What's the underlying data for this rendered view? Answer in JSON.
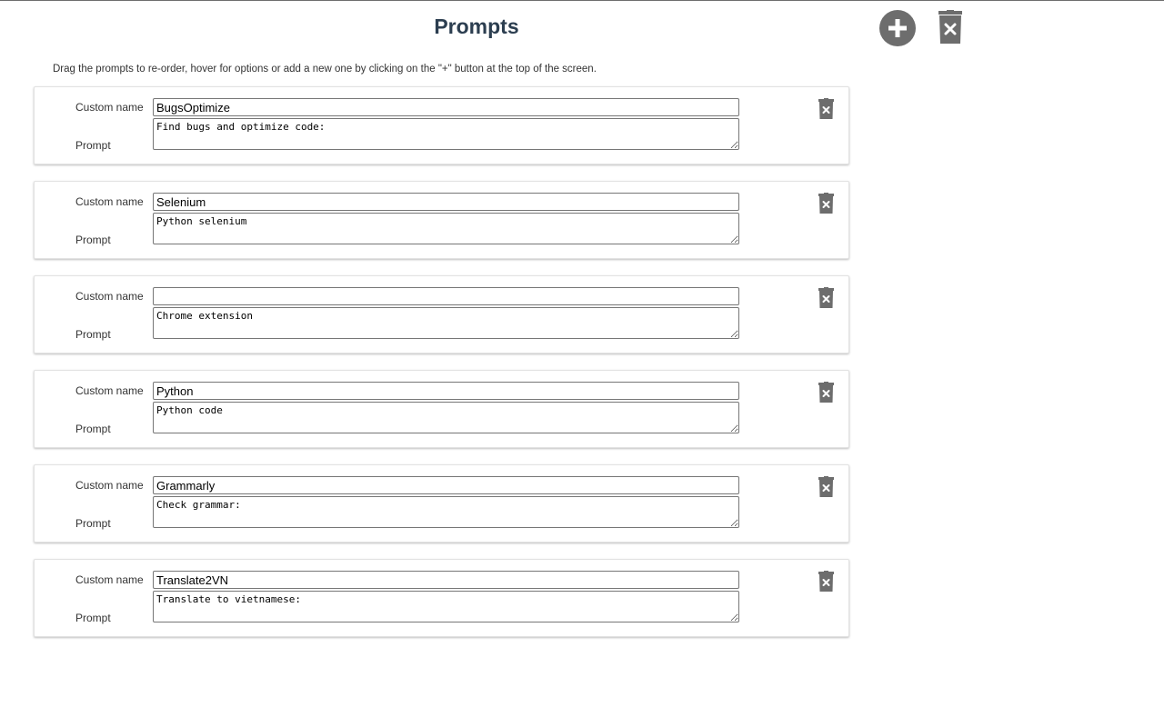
{
  "header": {
    "title": "Prompts",
    "add_icon": "plus-circle-icon",
    "clear_icon": "trash-x-icon"
  },
  "instructions": "Drag the prompts to re-order, hover for options or add a new one by clicking on the \"+\" button at the top of the screen.",
  "labels": {
    "custom_name": "Custom name",
    "prompt": "Prompt"
  },
  "prompts": [
    {
      "name": "BugsOptimize",
      "text": "Find bugs and optimize code:"
    },
    {
      "name": "Selenium",
      "text": "Python selenium"
    },
    {
      "name": "",
      "text": "Chrome extension"
    },
    {
      "name": "Python",
      "text": "Python code"
    },
    {
      "name": "Grammarly",
      "text": "Check grammar:"
    },
    {
      "name": "Translate2VN",
      "text": "Translate to vietnamese:"
    }
  ],
  "colors": {
    "title": "#2c3e50",
    "icon": "#6d6d6d"
  }
}
